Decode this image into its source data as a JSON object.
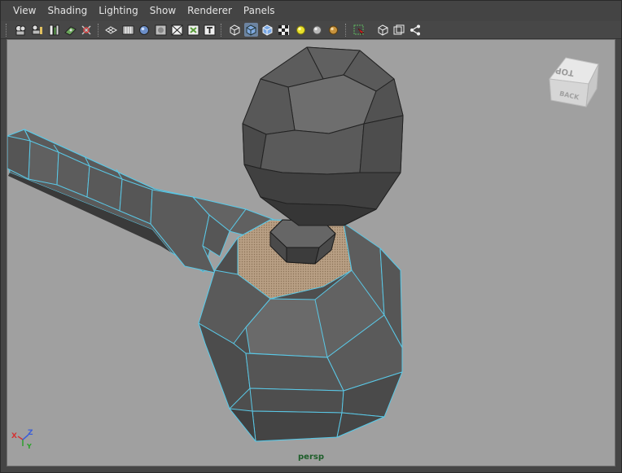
{
  "menu": {
    "items": [
      "View",
      "Shading",
      "Lighting",
      "Show",
      "Renderer",
      "Panels"
    ]
  },
  "toolbar": {
    "buttons": [
      "camera-select-icon",
      "camera-attributes-icon",
      "bookmark-icon",
      "image-plane-icon",
      "2d-pan-zoom-icon",
      "grid-icon",
      "film-gate-icon",
      "resolution-gate-icon",
      "gate-mask-icon",
      "field-chart-icon",
      "safe-action-icon",
      "safe-title-icon",
      "wireframe-icon",
      "smooth-shade-icon",
      "default-material-icon",
      "textured-icon",
      "use-all-lights-icon",
      "shadows-icon",
      "ambient-occlusion-icon",
      "isolate-select-icon",
      "xray-icon",
      "xray-active-components-icon",
      "xray-joints-icon"
    ],
    "active": [
      "smooth-shade-icon"
    ]
  },
  "viewport": {
    "camera_label": "persp",
    "background": "#a0a0a0",
    "wire_color": "#5ac8e6",
    "mesh_color": "#525252",
    "face_select_color": "#b29a80"
  },
  "view_cube": {
    "top_label": "TOP",
    "back_label": "BACK"
  },
  "axis": {
    "x_label": "X",
    "y_label": "Y",
    "z_label": "Z",
    "x_color": "#d33434",
    "y_color": "#2da12d",
    "z_color": "#3c5fd8"
  }
}
